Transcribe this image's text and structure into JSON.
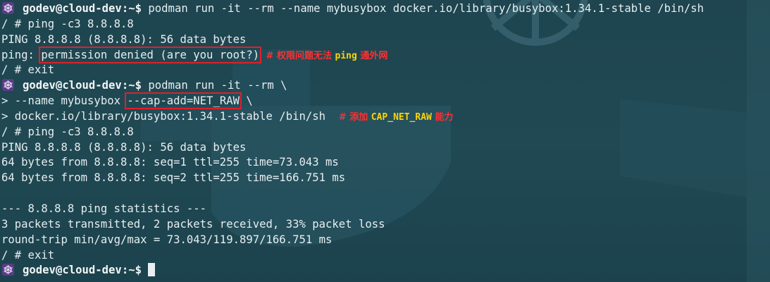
{
  "prompt": {
    "user_host": "godev@cloud-dev",
    "path": ":~$"
  },
  "lines": {
    "l1_cmd": " podman run -it --rm --name mybusybox docker.io/library/busybox:1.34.1-stable /bin/sh",
    "l2": "/ # ping -c3 8.8.8.8",
    "l3": "PING 8.8.8.8 (8.8.8.8): 56 data bytes",
    "l4_prefix": "ping: ",
    "l4_boxed": "permission denied (are you root?)",
    "l4_note_a": "# 权限问题无法 ",
    "l4_note_hl": "ping",
    "l4_note_b": " 通外网",
    "l5": "/ # exit",
    "l6_cmd": " podman run -it --rm \\",
    "l7_prefix": "> --name mybusybox ",
    "l7_boxed": "--cap-add=NET_RAW",
    "l7_suffix": " \\",
    "l8_prefix": "> docker.io/library/busybox:1.34.1-stable /bin/sh  ",
    "l8_note_a": "# 添加 ",
    "l8_note_hl": "CAP_NET_RAW",
    "l8_note_b": " 能力",
    "l9": "/ # ping -c3 8.8.8.8",
    "l10": "PING 8.8.8.8 (8.8.8.8): 56 data bytes",
    "l11": "64 bytes from 8.8.8.8: seq=1 ttl=255 time=73.043 ms",
    "l12": "64 bytes from 8.8.8.8: seq=2 ttl=255 time=166.751 ms",
    "l13": "",
    "l14": "--- 8.8.8.8 ping statistics ---",
    "l15": "3 packets transmitted, 2 packets received, 33% packet loss",
    "l16": "round-trip min/avg/max = 73.043/119.897/166.751 ms",
    "l17": "/ # exit"
  },
  "colors": {
    "background": "#1f4650",
    "text": "#e6eef0",
    "highlight_box": "#e0202a",
    "note": "#ff3030",
    "note_highlight": "#ffd400",
    "prompt_icon": "#5a3c86"
  },
  "icons": {
    "prompt": "kubernetes-wheel-icon"
  }
}
